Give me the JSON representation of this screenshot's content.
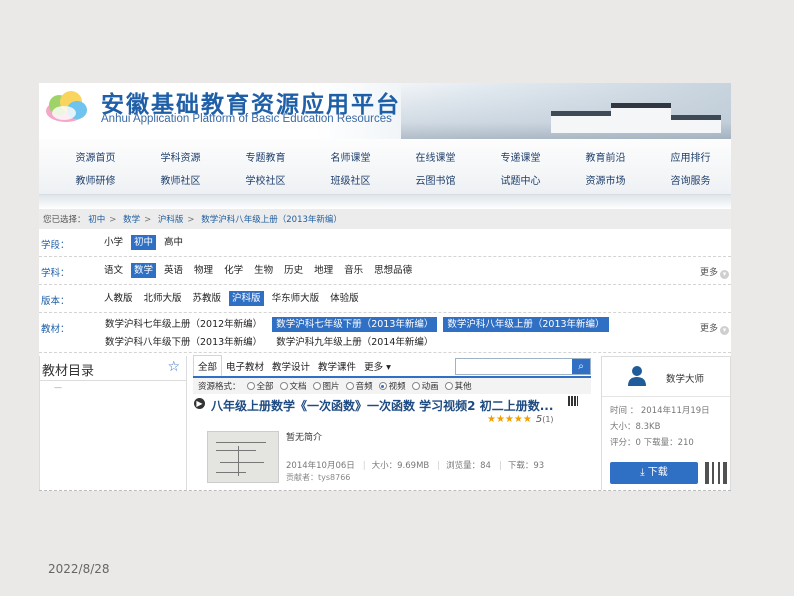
{
  "banner": {
    "title_zh": "安徽基础教育资源应用平台",
    "title_en": "Anhui Application Platform of Basic Education Resources"
  },
  "nav": {
    "row1": [
      "资源首页",
      "学科资源",
      "专题教育",
      "名师课堂",
      "在线课堂",
      "专递课堂",
      "教育前沿",
      "应用排行"
    ],
    "row2": [
      "教师研修",
      "教师社区",
      "学校社区",
      "班级社区",
      "云图书馆",
      "试题中心",
      "资源市场",
      "咨询服务"
    ]
  },
  "breadcrumb": {
    "prefix": "您已选择：",
    "items": [
      "初中",
      "数学",
      "沪科版",
      "数学沪科八年级上册（2013年新编）"
    ]
  },
  "filters": {
    "stage": {
      "label": "学段：",
      "options": [
        "小学",
        "初中",
        "高中"
      ],
      "selected": "初中"
    },
    "subject": {
      "label": "学科：",
      "options": [
        "语文",
        "数学",
        "英语",
        "物理",
        "化学",
        "生物",
        "历史",
        "地理",
        "音乐",
        "思想品德"
      ],
      "selected": "数学",
      "more": "更多"
    },
    "edition": {
      "label": "版本：",
      "options": [
        "人教版",
        "北师大版",
        "苏教版",
        "沪科版",
        "华东师大版",
        "体验版"
      ],
      "selected": "沪科版"
    },
    "textbook": {
      "label": "教材：",
      "options": [
        "数学沪科七年级上册（2012年新编）",
        "数学沪科七年级下册（2013年新编）",
        "数学沪科八年级上册（2013年新编）",
        "数学沪科八年级下册（2013年新编）",
        "数学沪科九年级上册（2014年新编）"
      ],
      "selected": [
        "数学沪科七年级下册（2013年新编）",
        "数学沪科八年级上册（2013年新编）"
      ],
      "more": "更多"
    }
  },
  "toc": {
    "title": "教材目录",
    "dash": "—"
  },
  "tabs": [
    "全部",
    "电子教材",
    "教学设计",
    "教学课件",
    "更多 ▾"
  ],
  "resource_types": {
    "label": "资源格式：",
    "options": [
      "全部",
      "文档",
      "图片",
      "音频",
      "视频",
      "动画",
      "其他"
    ],
    "selected": "视频"
  },
  "result": {
    "title": "八年级上册数学《一次函数》一次函数 学习视频2 初二上册数...",
    "stars": "★★★★★",
    "score": "5",
    "count": "(1)",
    "desc": "暂无简介",
    "date": "2014年10月06日",
    "size": "大小：9.69MB",
    "views": "浏览量：84",
    "downloads": "下载：93",
    "author": "贡献者：tys8766"
  },
  "card": {
    "name": "数学大师",
    "time": "时间 ： 2014年11月19日",
    "size": "大小：8.3KB",
    "rating": "评分：0  下载量：210",
    "download": "下载"
  },
  "footer_date": "2022/8/28",
  "colors": {
    "accent": "#2f6fc4",
    "title": "#1e5fa8",
    "star": "#f0a000"
  }
}
